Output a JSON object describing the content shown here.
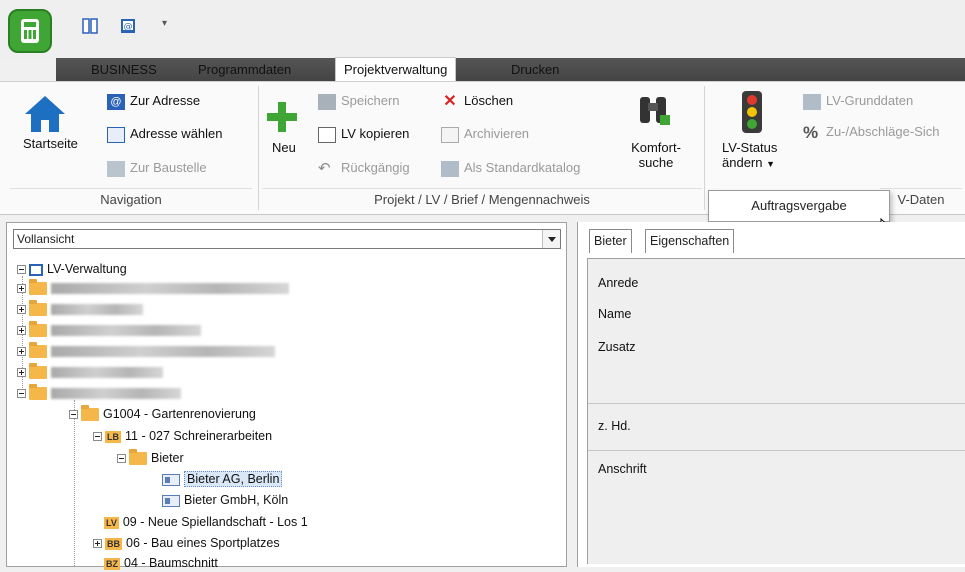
{
  "ribbon": {
    "tabs": [
      "BUSINESS",
      "Programmdaten",
      "Projektverwaltung",
      "Drucken"
    ],
    "navigation": {
      "startseite": "Startseite",
      "zur_adresse": "Zur Adresse",
      "adresse_waehlen": "Adresse wählen",
      "zur_baustelle": "Zur Baustelle",
      "group_label": "Navigation"
    },
    "projekt": {
      "neu": "Neu",
      "speichern": "Speichern",
      "loeschen": "Löschen",
      "lv_kopieren": "LV kopieren",
      "archivieren": "Archivieren",
      "rueckgaengig": "Rückgängig",
      "als_standardkatalog": "Als Standardkatalog",
      "komfort_line1": "Komfort-",
      "komfort_line2": "suche",
      "group_label": "Projekt / LV / Brief / Mengennachweis"
    },
    "lvdaten": {
      "lv_status_line1": "LV-Status",
      "lv_status_line2": "ändern",
      "lv_grunddaten": "LV-Grunddaten",
      "zu_abschlaege": "Zu-/Abschläge-Sich",
      "group_label_partial": "V-Daten"
    }
  },
  "dropdown_menu": {
    "item": "Auftragsvergabe"
  },
  "view_select": {
    "value": "Vollansicht"
  },
  "tree": {
    "root": "LV-Verwaltung",
    "project": "G1004 - Gartenrenovierung",
    "lb_badge": "LB",
    "lb_label": "11 - 027 Schreinerarbeiten",
    "bieter_folder": "Bieter",
    "bieter1": "Bieter AG, Berlin",
    "bieter2": "Bieter GmbH, Köln",
    "lv_badge": "LV",
    "lv_label": "09 - Neue Spiellandschaft - Los 1",
    "bb_badge": "BB",
    "bb_label": "06 - Bau eines Sportplatzes",
    "bz_badge": "BZ",
    "bz_label": "04 - Baumschnitt"
  },
  "detail": {
    "tabs": [
      "Bieter",
      "Eigenschaften"
    ],
    "fields": {
      "anrede": "Anrede",
      "name": "Name",
      "zusatz": "Zusatz",
      "zhd": "z. Hd.",
      "anschrift": "Anschrift"
    }
  },
  "colors": {
    "accent_green": "#3fa535",
    "ribbon_tab_bar": "#4d4d4d",
    "folder": "#f5b74a"
  }
}
